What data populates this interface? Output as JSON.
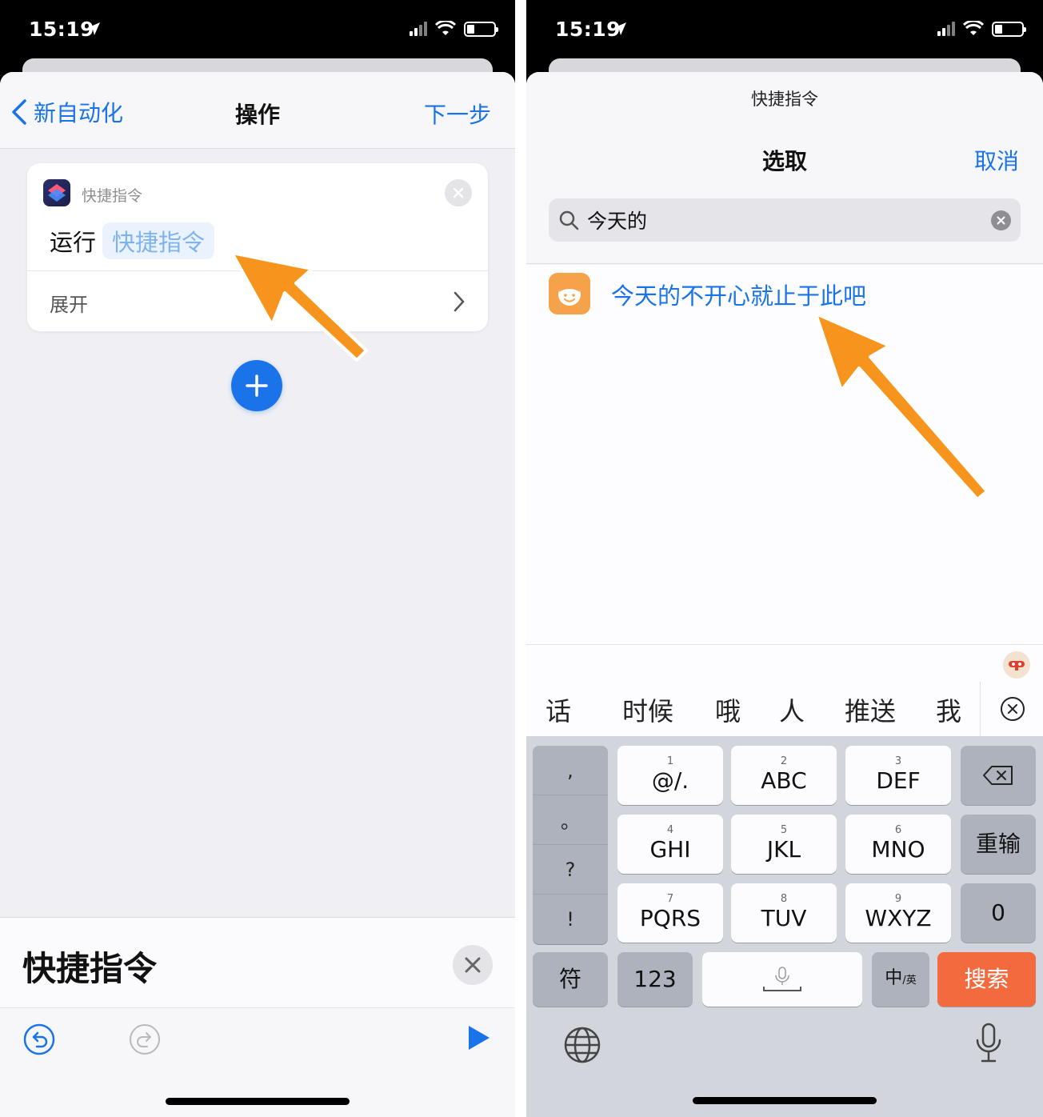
{
  "status": {
    "time": "15:19"
  },
  "left": {
    "nav": {
      "back_label": "新自动化",
      "title": "操作",
      "next_label": "下一步"
    },
    "card": {
      "app_name": "快捷指令",
      "run_label": "运行",
      "run_token": "快捷指令",
      "expand_label": "展开"
    },
    "bottom_panel": {
      "title": "快捷指令"
    }
  },
  "right": {
    "header": {
      "small_title": "快捷指令",
      "title": "选取",
      "cancel_label": "取消"
    },
    "search": {
      "value": "今天的"
    },
    "result": {
      "label": "今天的不开心就止于此吧"
    },
    "candidates": [
      "话",
      "时候",
      "哦",
      "人",
      "推送",
      "我"
    ],
    "keyboard": {
      "punct": [
        ",",
        "。",
        "?",
        "!"
      ],
      "keys": [
        {
          "num": "1",
          "main": "@/."
        },
        {
          "num": "2",
          "main": "ABC"
        },
        {
          "num": "3",
          "main": "DEF"
        },
        {
          "num": "4",
          "main": "GHI"
        },
        {
          "num": "5",
          "main": "JKL"
        },
        {
          "num": "6",
          "main": "MNO"
        },
        {
          "num": "7",
          "main": "PQRS"
        },
        {
          "num": "8",
          "main": "TUV"
        },
        {
          "num": "9",
          "main": "WXYZ"
        }
      ],
      "reenter": "重输",
      "zero": "0",
      "symbol": "符",
      "num_switch": "123",
      "lang_main": "中",
      "lang_sub": "/英",
      "search_key": "搜索"
    }
  },
  "colors": {
    "accent": "#1a73e8",
    "arrow": "#f7941d",
    "search_key": "#f26a3e"
  }
}
